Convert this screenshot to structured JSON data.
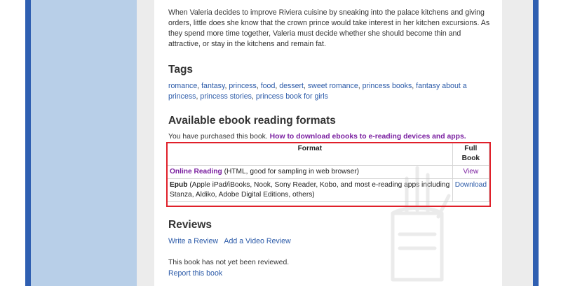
{
  "description": "When Valeria decides to improve Riviera cuisine by sneaking into the palace kitchens and giving orders, little does she know that the crown prince would take interest in her kitchen excursions. As they spend more time together, Valeria must decide whether she should become thin and attractive, or stay in the kitchens and remain fat.",
  "tags": {
    "heading": "Tags",
    "items": [
      "romance",
      "fantasy",
      "princess",
      "food",
      "dessert",
      "sweet romance",
      "princess books",
      "fantasy about a princess",
      "princess stories",
      "princess book for girls"
    ]
  },
  "formats": {
    "heading": "Available ebook reading formats",
    "purchased_text": "You have purchased this book.",
    "how_to_link": "How to download ebooks to e-reading devices and apps.",
    "col_format": "Format",
    "col_full_book": "Full Book",
    "rows": [
      {
        "name": "Online Reading",
        "detail": "(HTML, good for sampling in web browser)",
        "action": "View"
      },
      {
        "name": "Epub",
        "detail": "(Apple iPad/iBooks, Nook, Sony Reader, Kobo, and most e-reading apps including Stanza, Aldiko, Adobe Digital Editions, others)",
        "action": "Download"
      }
    ]
  },
  "reviews": {
    "heading": "Reviews",
    "write_link": "Write a Review",
    "video_link": "Add a Video Review",
    "empty_text": "This book has not yet been reviewed.",
    "report_link": "Report this book"
  },
  "colors": {
    "highlight_border": "#e0202a",
    "link": "#2b5aa8",
    "purple_link": "#7a1fa0",
    "sidebar_blue": "#2f5fb1"
  }
}
